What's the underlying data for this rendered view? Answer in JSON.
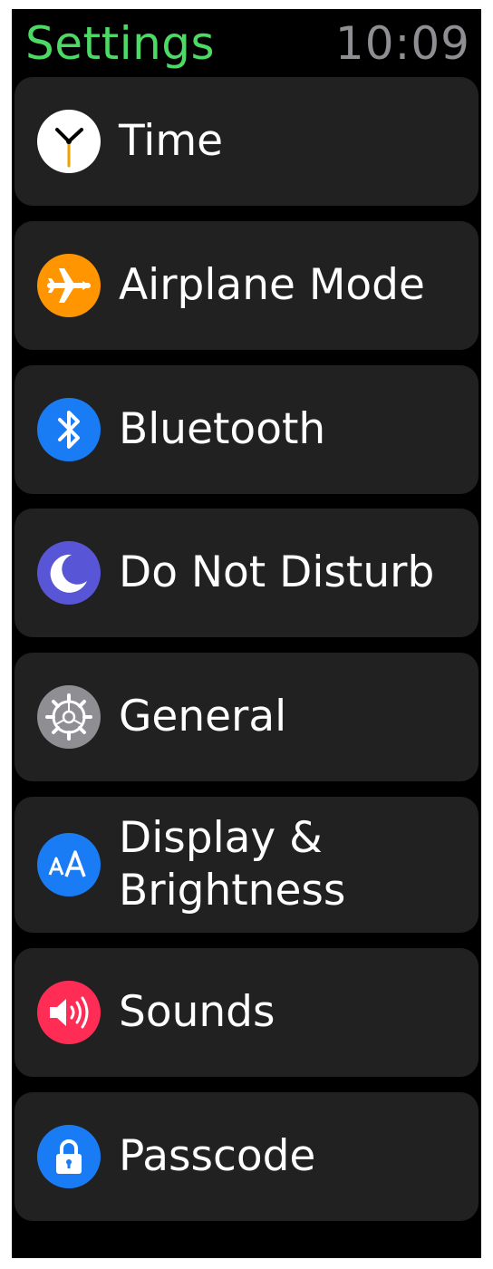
{
  "header": {
    "title": "Settings",
    "time": "10:09"
  },
  "colors": {
    "title": "#4cd964",
    "time": "#8e8e93",
    "row_bg": "#212121"
  },
  "items": [
    {
      "label": "Time",
      "icon": "clock-icon",
      "icon_color": "#ffffff"
    },
    {
      "label": "Airplane Mode",
      "icon": "airplane-icon",
      "icon_color": "#ff9500"
    },
    {
      "label": "Bluetooth",
      "icon": "bluetooth-icon",
      "icon_color": "#1a7cf5"
    },
    {
      "label": "Do Not Disturb",
      "icon": "moon-icon",
      "icon_color": "#5856d6"
    },
    {
      "label": "General",
      "icon": "gear-icon",
      "icon_color": "#8e8e93"
    },
    {
      "label": "Display & Brightness",
      "icon": "text-size-icon",
      "icon_color": "#1a7cf5"
    },
    {
      "label": "Sounds",
      "icon": "speaker-icon",
      "icon_color": "#ff2d55"
    },
    {
      "label": "Passcode",
      "icon": "lock-icon",
      "icon_color": "#1a7cf5"
    }
  ]
}
